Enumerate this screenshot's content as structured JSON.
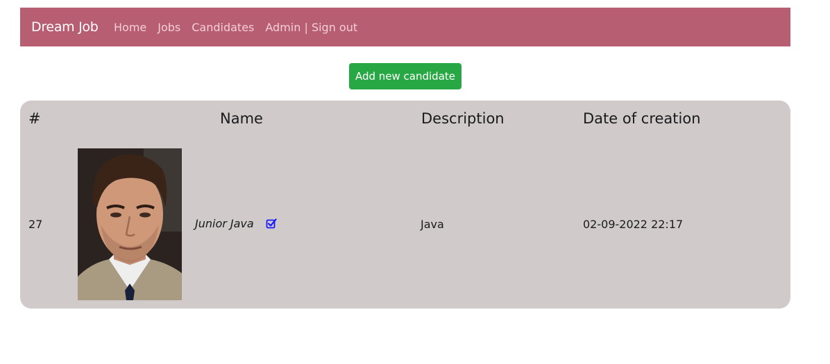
{
  "navbar": {
    "brand": "Dream Job",
    "links": [
      "Home",
      "Jobs",
      "Candidates",
      "Admin | Sign out"
    ],
    "background_color": "#b85e72"
  },
  "actions": {
    "add_candidate_label": "Add new candidate",
    "button_color": "#28a745"
  },
  "table": {
    "headers": {
      "number": "#",
      "name": "Name",
      "description": "Description",
      "date": "Date of creation"
    },
    "rows": [
      {
        "id": "27",
        "name": "Junior Java",
        "description": "Java",
        "date": "02-09-2022 22:17",
        "edit_icon": "edit-checkbox-icon",
        "photo": "candidate-photo"
      }
    ],
    "background_color": "#d0cacb"
  }
}
